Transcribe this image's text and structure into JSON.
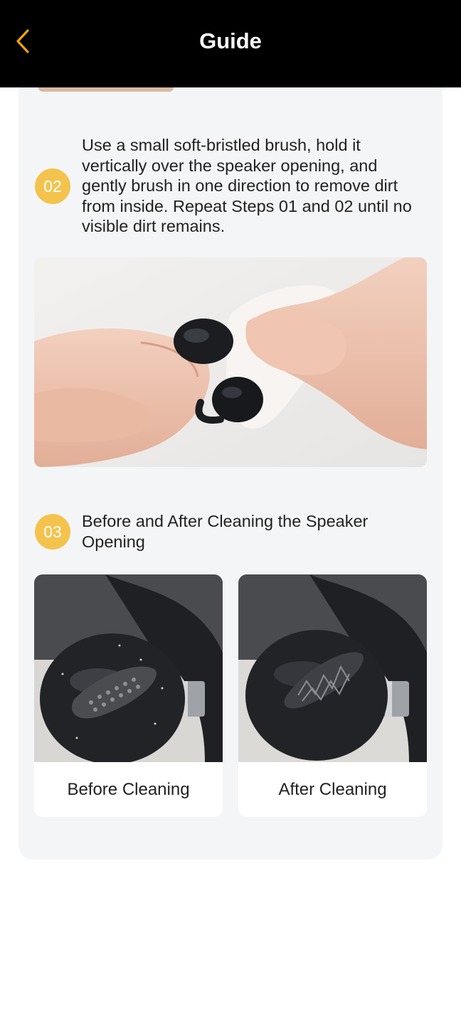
{
  "header": {
    "title": "Guide",
    "back_icon": "chevron-left-icon",
    "accent_color": "#f0a500"
  },
  "steps": [
    {
      "number": "02",
      "text": "Use a small soft-bristled brush, hold it vertically over the speaker opening, and gently brush in one direction to remove dirt from inside. Repeat Steps 01 and 02 until no visible dirt remains."
    },
    {
      "number": "03",
      "text": "Before and After Cleaning the Speaker Opening"
    }
  ],
  "comparison": {
    "before_label": "Before Cleaning",
    "after_label": "After Cleaning"
  },
  "colors": {
    "badge": "#f3c34d",
    "card_background": "#f4f5f7"
  }
}
